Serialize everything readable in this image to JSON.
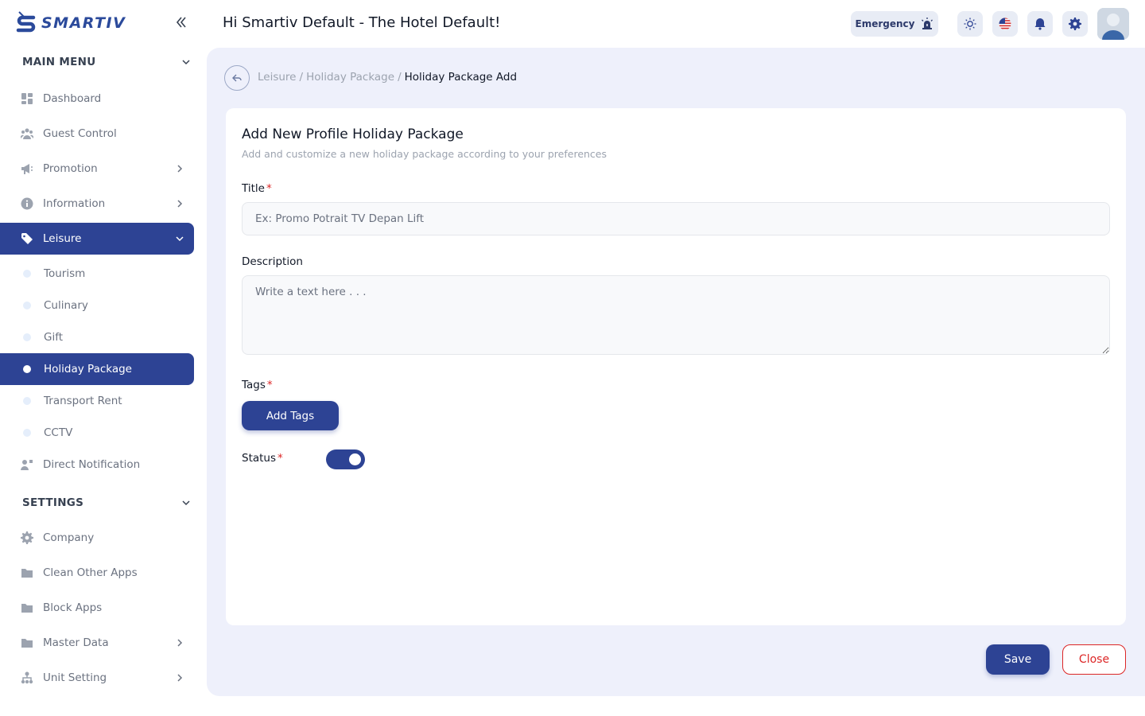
{
  "app": {
    "logo_text": "SMARTIV"
  },
  "header": {
    "greeting": "Hi Smartiv Default - The Hotel Default!",
    "emergency_label": "Emergency"
  },
  "sidebar": {
    "main_menu_label": "MAIN MENU",
    "main_items": [
      {
        "label": "Dashboard",
        "icon": "dashboard-icon"
      },
      {
        "label": "Guest Control",
        "icon": "users-icon"
      },
      {
        "label": "Promotion",
        "icon": "megaphone-icon"
      },
      {
        "label": "Information",
        "icon": "info-icon"
      },
      {
        "label": "Leisure",
        "icon": "tag-icon"
      }
    ],
    "leisure_sub": [
      "Tourism",
      "Culinary",
      "Gift",
      "Holiday Package",
      "Transport Rent",
      "CCTV"
    ],
    "direct_notification": "Direct Notification",
    "settings_label": "SETTINGS",
    "settings_items": [
      {
        "label": "Company",
        "icon": "gear-icon"
      },
      {
        "label": "Clean Other Apps",
        "icon": "folder-icon"
      },
      {
        "label": "Block Apps",
        "icon": "folder-icon"
      },
      {
        "label": "Master Data",
        "icon": "folder-icon"
      },
      {
        "label": "Unit Setting",
        "icon": "hierarchy-icon"
      }
    ],
    "active_item": "Leisure",
    "active_sub_item": "Holiday Package"
  },
  "breadcrumb": {
    "items": [
      "Leisure",
      "Holiday Package"
    ],
    "current": "Holiday Package Add"
  },
  "form": {
    "title": "Add New Profile Holiday Package",
    "subtitle": "Add and customize a new holiday package according to your preferences",
    "title_label": "Title",
    "title_placeholder": "Ex: Promo Potrait TV Depan Lift",
    "description_label": "Description",
    "description_placeholder": "Write a text here . . .",
    "tags_label": "Tags",
    "add_tags_label": "Add Tags",
    "status_label": "Status",
    "status_on": true,
    "required_marker": "*"
  },
  "actions": {
    "save_label": "Save",
    "close_label": "Close"
  },
  "colors": {
    "primary": "#2d4394",
    "danger": "#dc2626",
    "main_bg": "#eef0fb"
  }
}
